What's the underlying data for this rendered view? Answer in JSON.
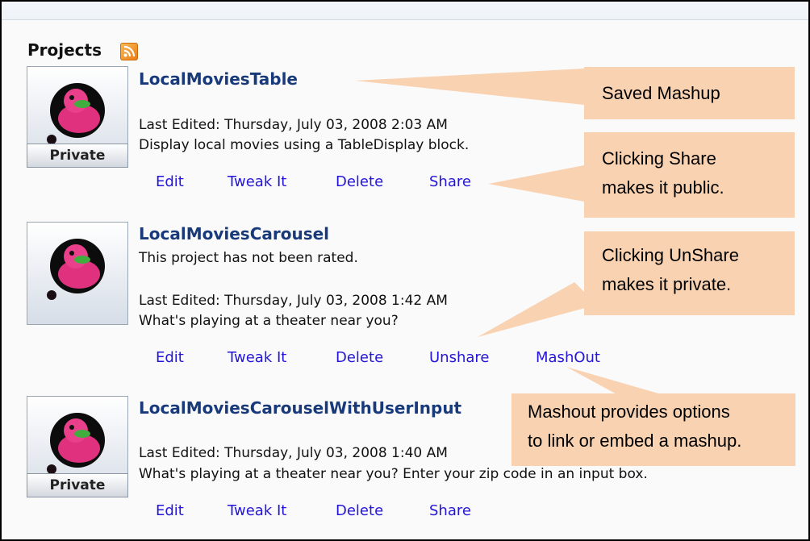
{
  "section": {
    "title": "Projects",
    "rss_icon": "rss-icon"
  },
  "projects": [
    {
      "title": "LocalMoviesTable",
      "rating": "",
      "edited": "Last Edited: Thursday, July 03, 2008 2:03 AM",
      "description": "Display local movies using a TableDisplay block.",
      "badge": "Private",
      "actions": [
        "Edit",
        "Tweak It",
        "Delete",
        "Share"
      ]
    },
    {
      "title": "LocalMoviesCarousel",
      "rating": "This project has not been rated.",
      "edited": "Last Edited: Thursday, July 03, 2008 1:42 AM",
      "description": "What's playing at a theater near you?",
      "badge": "",
      "actions": [
        "Edit",
        "Tweak It",
        "Delete",
        "Unshare",
        "MashOut"
      ]
    },
    {
      "title": "LocalMoviesCarouselWithUserInput",
      "rating": "",
      "edited": "Last Edited: Thursday, July 03, 2008 1:40 AM",
      "description": "What's playing at a theater near you? Enter your zip code in an input box.",
      "badge": "Private",
      "actions": [
        "Edit",
        "Tweak It",
        "Delete",
        "Share"
      ]
    }
  ],
  "callouts": [
    {
      "lines": [
        "Saved Mashup"
      ]
    },
    {
      "lines": [
        "Clicking Share",
        "makes it public."
      ]
    },
    {
      "lines": [
        "Clicking UnShare",
        "makes it private."
      ]
    },
    {
      "lines": [
        "Mashout provides options",
        "to link or embed a mashup."
      ]
    }
  ],
  "colors": {
    "link": "#2416d8",
    "title": "#183a7a",
    "callout": "#f9d2b2"
  }
}
